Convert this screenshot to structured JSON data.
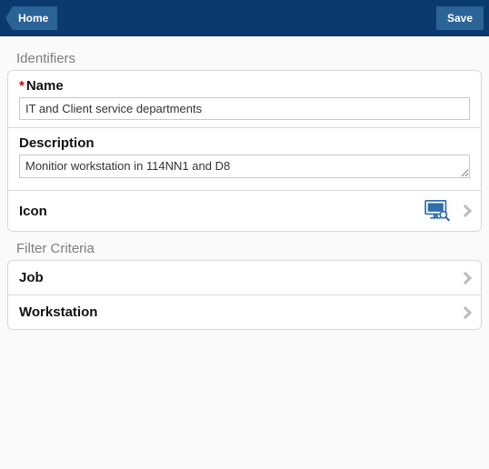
{
  "topbar": {
    "home_label": "Home",
    "save_label": "Save"
  },
  "sections": {
    "identifiers_title": "Identifiers",
    "filter_criteria_title": "Filter Criteria"
  },
  "identifiers": {
    "name_label": "Name",
    "name_required_marker": "*",
    "name_value": "IT and Client service departments",
    "description_label": "Description",
    "description_value": "Monitior workstation in 114NN1 and D8",
    "icon_label": "Icon",
    "icon_name": "monitor-search-icon"
  },
  "filter_criteria": {
    "job_label": "Job",
    "workstation_label": "Workstation"
  },
  "colors": {
    "topbar_bg": "#0b3a6f",
    "button_bg": "#2a6396",
    "icon_blue": "#2f6fb0"
  }
}
